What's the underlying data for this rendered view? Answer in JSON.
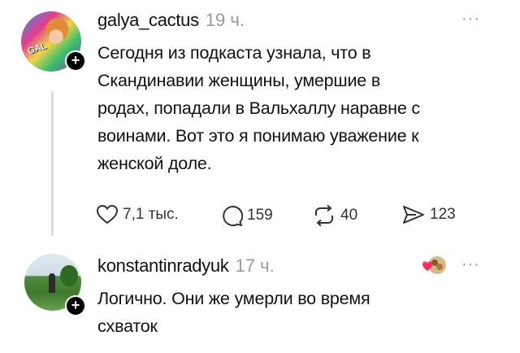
{
  "post": {
    "username": "galya_cactus",
    "time": "19 ч.",
    "more": "···",
    "lines": [
      "Сегодня из подкаста узнала, что в",
      "Скандинавии женщины, умершие в",
      "родах, попадали в Вальхаллу наравне с",
      "воинами. Вот это я понимаю уважение к",
      "женской доле."
    ],
    "avatar_text": "GAL",
    "actions": {
      "likes": "7,1 тыс.",
      "comments": "159",
      "reposts": "40",
      "shares": "123"
    },
    "icons": {
      "likes": "heart-icon",
      "comments": "comment-bubble-icon",
      "reposts": "repost-icon",
      "shares": "send-icon"
    }
  },
  "reply": {
    "username": "konstantinradyuk",
    "time": "17 ч.",
    "more": "···",
    "lines": [
      "Логично. Они же умерли во время",
      "схваток"
    ]
  },
  "plus_symbol": "+"
}
